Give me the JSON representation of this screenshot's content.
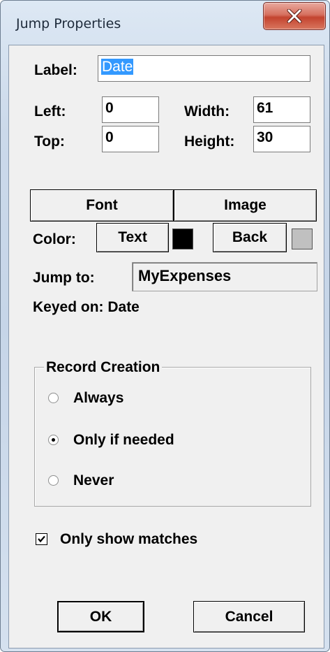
{
  "window": {
    "title": "Jump Properties",
    "close_glyph": "x"
  },
  "label_field": {
    "label": "Label:",
    "value": "Date"
  },
  "left_field": {
    "label": "Left:",
    "value": "0"
  },
  "width_field": {
    "label": "Width:",
    "value": "61"
  },
  "top_field": {
    "label": "Top:",
    "value": "0"
  },
  "height_field": {
    "label": "Height:",
    "value": "30"
  },
  "buttons": {
    "font": "Font",
    "image": "Image",
    "text": "Text",
    "back": "Back",
    "ok": "OK",
    "cancel": "Cancel"
  },
  "color": {
    "label": "Color:",
    "text_color": "#000000",
    "back_color": "#c0c0c0"
  },
  "jump_to": {
    "label": "Jump to:",
    "value": "MyExpenses"
  },
  "keyed_on": "Keyed on: Date",
  "record_creation": {
    "title": "Record Creation",
    "options": [
      {
        "label": "Always",
        "selected": false
      },
      {
        "label": "Only if needed",
        "selected": true
      },
      {
        "label": "Never",
        "selected": false
      }
    ]
  },
  "only_show_matches": {
    "label": "Only show matches",
    "checked": true
  }
}
